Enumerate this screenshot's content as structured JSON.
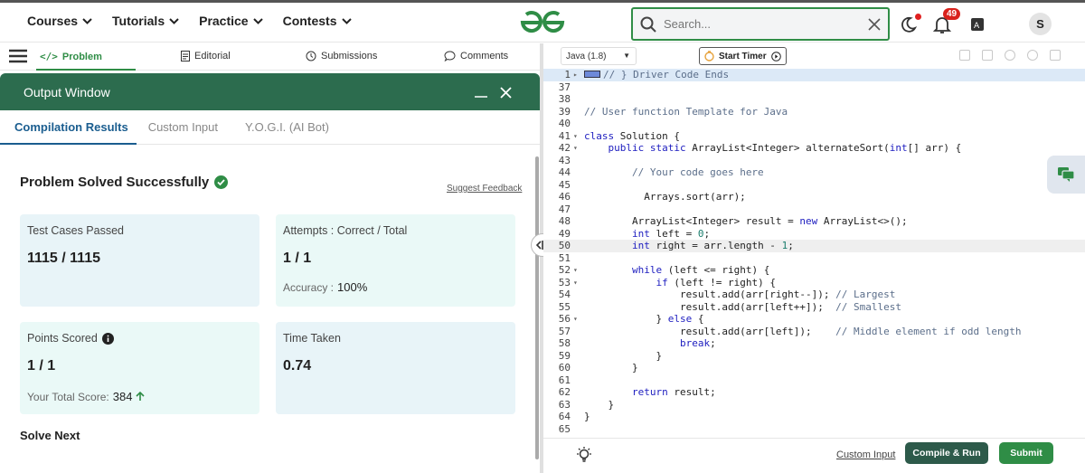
{
  "nav": {
    "items": [
      "Courses",
      "Tutorials",
      "Practice",
      "Contests"
    ],
    "search_placeholder": "Search...",
    "notification_count": "49",
    "avatar_initial": "S"
  },
  "problem_tabs": {
    "problem": "Problem",
    "editorial": "Editorial",
    "submissions": "Submissions",
    "comments": "Comments"
  },
  "output_window": {
    "title": "Output Window",
    "tabs": [
      "Compilation Results",
      "Custom Input",
      "Y.O.G.I. (AI Bot)"
    ],
    "status": "Problem Solved Successfully",
    "suggest_feedback": "Suggest Feedback",
    "test_cases_label": "Test Cases Passed",
    "test_cases_value": "1115 / 1115",
    "attempts_label": "Attempts : Correct / Total",
    "attempts_value": "1 / 1",
    "accuracy_label": "Accuracy :",
    "accuracy_value": "100%",
    "points_label": "Points Scored",
    "points_value": "1 / 1",
    "total_score_label": "Your Total Score:",
    "total_score_value": "384",
    "time_label": "Time Taken",
    "time_value": "0.74",
    "solve_next": "Solve Next"
  },
  "editor": {
    "language": "Java (1.8)",
    "timer_label": "Start Timer",
    "lines": [
      {
        "n": "1",
        "fold": true,
        "text": "// } Driver Code Ends"
      },
      {
        "n": "37",
        "fold": false,
        "text": ""
      },
      {
        "n": "38",
        "fold": false,
        "text": ""
      },
      {
        "n": "39",
        "fold": false,
        "text": "// User function Template for Java"
      },
      {
        "n": "40",
        "fold": false,
        "text": ""
      },
      {
        "n": "41",
        "fold": true,
        "text": "class Solution {"
      },
      {
        "n": "42",
        "fold": true,
        "text": "    public static ArrayList<Integer> alternateSort(int[] arr) {"
      },
      {
        "n": "43",
        "fold": false,
        "text": ""
      },
      {
        "n": "44",
        "fold": false,
        "text": "        // Your code goes here"
      },
      {
        "n": "45",
        "fold": false,
        "text": ""
      },
      {
        "n": "46",
        "fold": false,
        "text": "          Arrays.sort(arr);"
      },
      {
        "n": "47",
        "fold": false,
        "text": ""
      },
      {
        "n": "48",
        "fold": false,
        "text": "        ArrayList<Integer> result = new ArrayList<>();"
      },
      {
        "n": "49",
        "fold": false,
        "text": "        int left = 0;"
      },
      {
        "n": "50",
        "fold": false,
        "text": "        int right = arr.length - 1;"
      },
      {
        "n": "51",
        "fold": false,
        "text": ""
      },
      {
        "n": "52",
        "fold": true,
        "text": "        while (left <= right) {"
      },
      {
        "n": "53",
        "fold": true,
        "text": "            if (left != right) {"
      },
      {
        "n": "54",
        "fold": false,
        "text": "                result.add(arr[right--]); // Largest"
      },
      {
        "n": "55",
        "fold": false,
        "text": "                result.add(arr[left++]);  // Smallest"
      },
      {
        "n": "56",
        "fold": true,
        "text": "            } else {"
      },
      {
        "n": "57",
        "fold": false,
        "text": "                result.add(arr[left]);    // Middle element if odd length"
      },
      {
        "n": "58",
        "fold": false,
        "text": "                break;"
      },
      {
        "n": "59",
        "fold": false,
        "text": "            }"
      },
      {
        "n": "60",
        "fold": false,
        "text": "        }"
      },
      {
        "n": "61",
        "fold": false,
        "text": ""
      },
      {
        "n": "62",
        "fold": false,
        "text": "        return result;"
      },
      {
        "n": "63",
        "fold": false,
        "text": "    }"
      },
      {
        "n": "64",
        "fold": false,
        "text": "}"
      },
      {
        "n": "65",
        "fold": false,
        "text": ""
      }
    ],
    "custom_input": "Custom Input",
    "compile_run": "Compile & Run",
    "submit": "Submit"
  },
  "colors": {
    "brand_green": "#2f8d46",
    "output_header": "#2c6c4e",
    "active_tab_blue": "#1a5d8f",
    "compile_btn": "#2d5a4a",
    "submit_btn": "#2f8d46"
  }
}
